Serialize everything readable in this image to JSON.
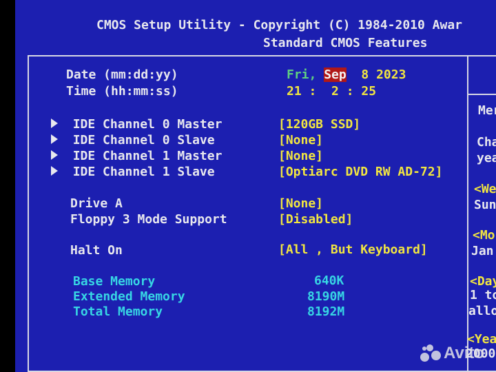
{
  "header": {
    "title": "CMOS Setup Utility - Copyright (C) 1984-2010 Awar",
    "subtitle": "Standard CMOS Features"
  },
  "date": {
    "label": "Date (mm:dd:yy)",
    "day": "Fri,",
    "month": "Sep",
    "date": "8",
    "year": "2023"
  },
  "time": {
    "label": "Time (hh:mm:ss)",
    "value": "21 :  2 : 25"
  },
  "ide": [
    {
      "label": "IDE Channel 0 Master",
      "value": "[120GB SSD]"
    },
    {
      "label": "IDE Channel 0 Slave",
      "value": "[None]"
    },
    {
      "label": "IDE Channel 1 Master",
      "value": "[None]"
    },
    {
      "label": "IDE Channel 1 Slave",
      "value": "[Optiarc DVD RW AD-72]"
    }
  ],
  "drive_a": {
    "label": "Drive A",
    "value": "[None]"
  },
  "floppy": {
    "label": "Floppy 3 Mode Support",
    "value": "[Disabled]"
  },
  "halt": {
    "label": "Halt On",
    "value": "[All , But Keyboard]"
  },
  "memory": [
    {
      "label": "Base Memory",
      "value": "640K"
    },
    {
      "label": "Extended Memory",
      "value": "8190M"
    },
    {
      "label": "Total Memory",
      "value": "8192M"
    }
  ],
  "help": {
    "menu": "Mer",
    "line1": "Cha",
    "line2": "yea",
    "week_h": "<We",
    "week_v": "Sun",
    "month_h": "<Mo",
    "month_v": "Jan",
    "day_h": "<Day",
    "day_v1": "1 to",
    "day_v2": "allo",
    "year_h": "<Yea",
    "year_v": "2000"
  },
  "watermark": "Avito",
  "colors": {
    "background": "#1c1fb0",
    "text": "#e8e8ee",
    "value": "#f2e640",
    "memory": "#37d6e4",
    "day": "#5fd080",
    "selected": "#b01818"
  }
}
